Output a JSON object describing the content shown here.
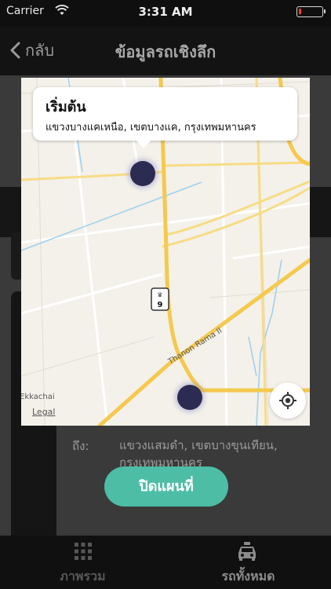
{
  "status_bar": {
    "carrier": "Carrier",
    "time": "3:31 AM"
  },
  "nav": {
    "back_label": "กลับ",
    "title": "ข้อมูลรถเชิงลึก"
  },
  "background": {
    "to_label": "ถึง:",
    "to_address": "แขวงแสมดำ, เขตบางขุนเทียน, กรุงเทพมหานคร"
  },
  "map": {
    "callout_title": "เริ่มต้น",
    "callout_address": "แขวงบางแคเหนือ, เขตบางแค, กรุงเทพมหานคร",
    "route_shield": "9",
    "road_label": "Thanon Rama II",
    "place_label": "Ekkachai",
    "legal": "Legal"
  },
  "close_button": "ปิดแผนที่",
  "tabs": [
    {
      "label": "ภาพรวม",
      "icon": "grid-icon"
    },
    {
      "label": "รถทั้งหมด",
      "icon": "taxi-icon"
    }
  ],
  "colors": {
    "accent": "#4dbda6",
    "pin": "#2c2b52",
    "road_major": "#f5c94e"
  }
}
